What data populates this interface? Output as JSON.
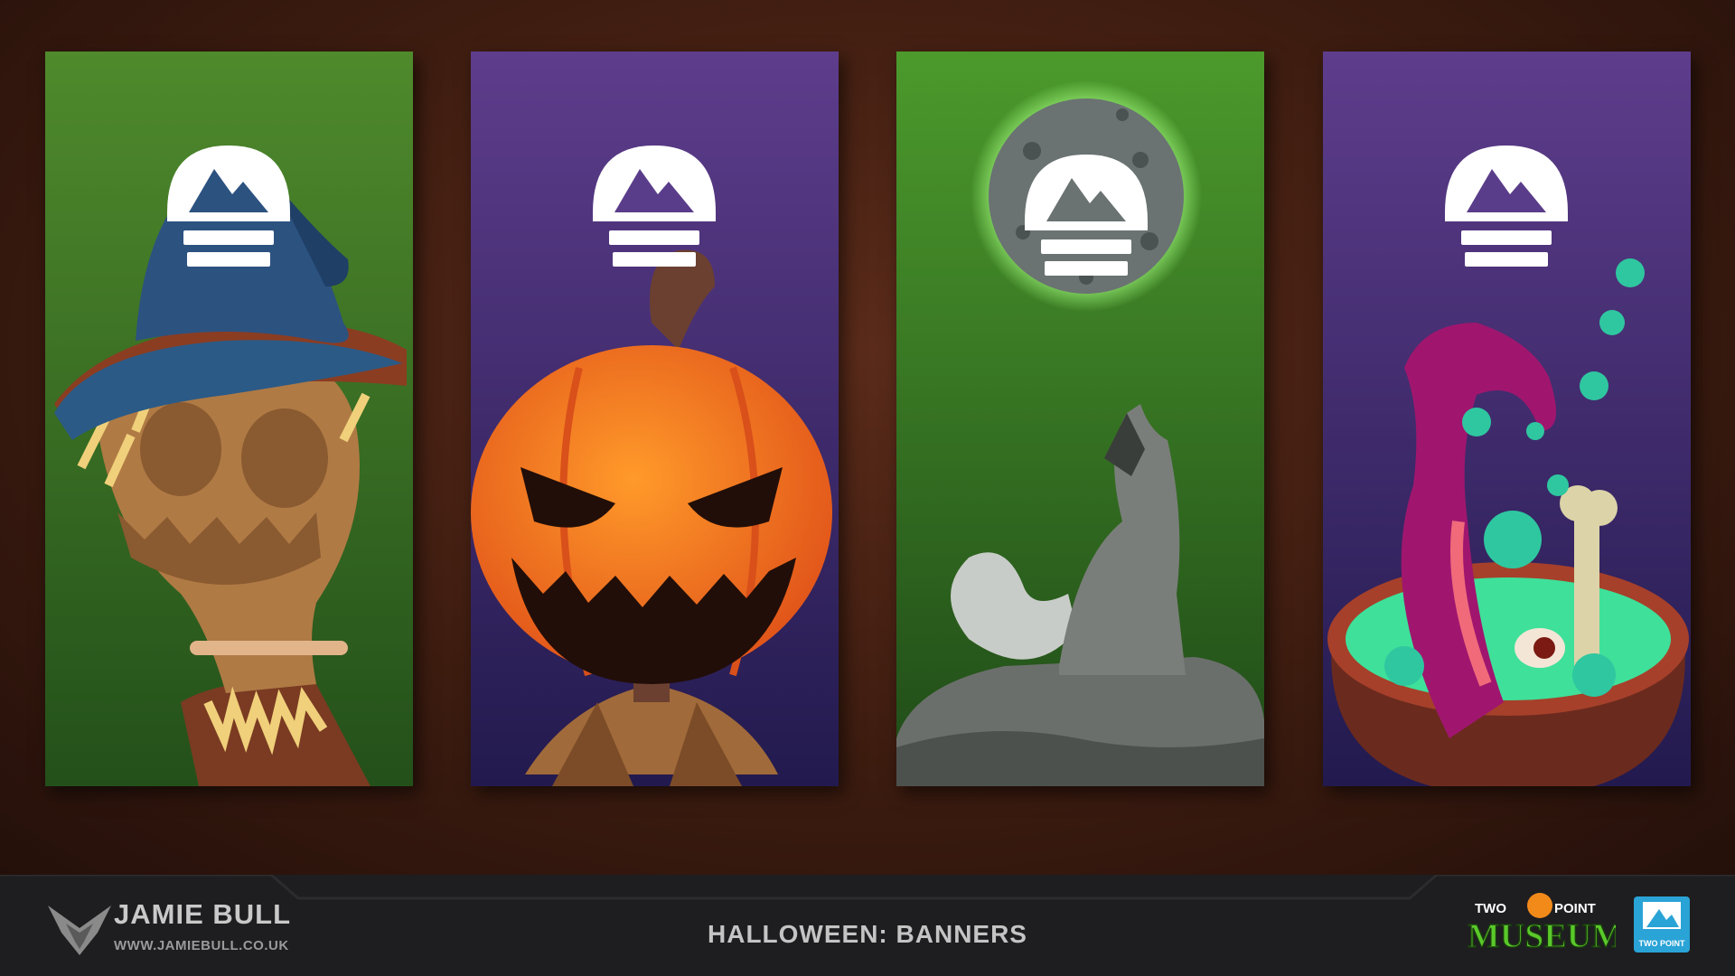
{
  "colors": {
    "green_banner": "#4d8a2b",
    "purple_banner": "#5a3a8a",
    "footer_bg": "#1e1e20",
    "wood_bg": "#3d1c10",
    "emblem_white": "#ffffff",
    "museum_green": "#5ac92a",
    "studio_blue": "#2aa3d6"
  },
  "banners": [
    {
      "theme": "scarecrow",
      "background": "green",
      "icon": "scarecrow-icon"
    },
    {
      "theme": "jack-o-lantern",
      "background": "purple",
      "icon": "pumpkin-icon"
    },
    {
      "theme": "werewolf-moon",
      "background": "green",
      "icon": "wolf-icon"
    },
    {
      "theme": "witch-cauldron",
      "background": "purple",
      "icon": "cauldron-icon"
    }
  ],
  "footer": {
    "author_name": "JAMIE BULL",
    "author_url": "WWW.JAMIEBULL.CO.UK",
    "title": "HALLOWEEN: BANNERS",
    "game_logo_top_left": "TWO",
    "game_logo_top_right": "POINT",
    "game_logo_main": "MUSEUM",
    "studio_label": "TWO POINT"
  }
}
